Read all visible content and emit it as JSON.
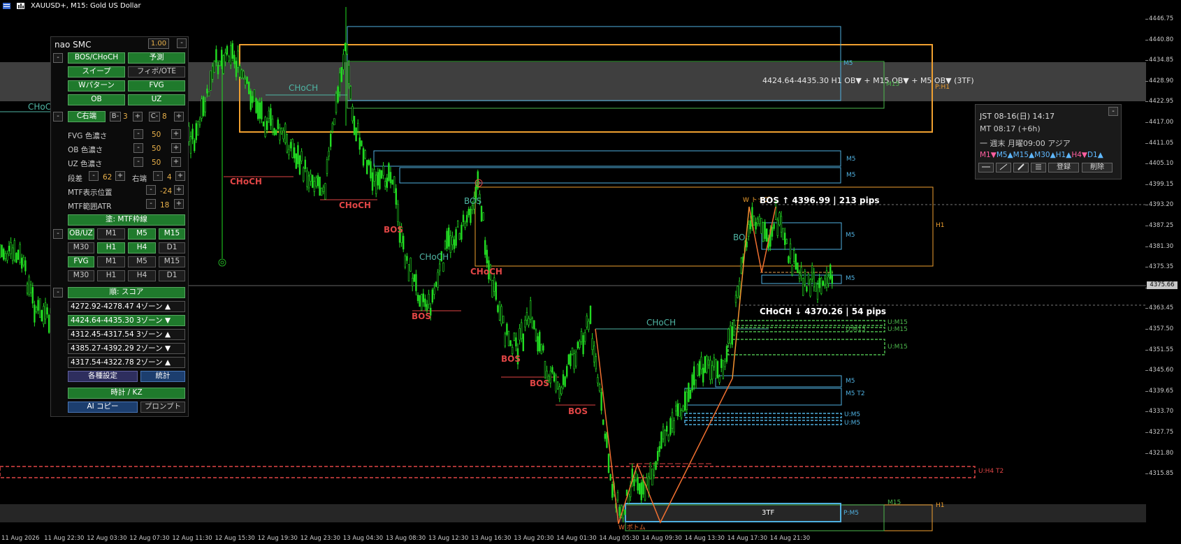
{
  "window": {
    "title": "XAUUSD+, M15:  Gold US Dollar"
  },
  "price_axis": {
    "ticks": [
      "4446.75",
      "4440.80",
      "4434.85",
      "4428.90",
      "4422.95",
      "4417.00",
      "4411.05",
      "4405.10",
      "4399.15",
      "4393.20",
      "4387.25",
      "4381.30",
      "4375.35",
      "4369.40",
      "4363.45",
      "4357.50",
      "4351.55",
      "4345.60",
      "4339.65",
      "4333.70",
      "4327.75",
      "4321.80",
      "4315.85"
    ],
    "current": "4375.66"
  },
  "time_axis": {
    "ticks": [
      "11 Aug 2026",
      "11 Aug 22:30",
      "12 Aug 03:30",
      "12 Aug 07:30",
      "12 Aug 11:30",
      "12 Aug 15:30",
      "12 Aug 19:30",
      "12 Aug 23:30",
      "13 Aug 04:30",
      "13 Aug 08:30",
      "13 Aug 12:30",
      "13 Aug 16:30",
      "13 Aug 20:30",
      "14 Aug 01:30",
      "14 Aug 05:30",
      "14 Aug 09:30",
      "14 Aug 13:30",
      "14 Aug 17:30",
      "14 Aug 21:30"
    ]
  },
  "chart_labels": {
    "choch_left": "CHoCH",
    "choch_teal_1": "CHoCH",
    "choch_red_1": "CHoCH",
    "choch_red_2": "CHoCH",
    "bos_red_1": "BOS",
    "choch_teal_2": "CHoCH",
    "bos_red_2": "BOS",
    "choch_teal_3": "BOS",
    "choch_red_3": "CHoCH",
    "bos_red_3": "BOS",
    "bos_red_4": "BOS",
    "bos_red_5": "BOS",
    "choch_teal_4": "CHoCH",
    "bo_teal": "BO",
    "zone_info": "4424.64-4435.30  H1 OB▼ + M15 OB▼ + M5 OB▼ (3TF)",
    "bos_info": "BOS ↑  4396.99  |  213 pips",
    "choch_info": "CHoCH ↓  4370.26  |  54 pips",
    "w_label": "W トップ",
    "w_bottom": "W ボトム",
    "m5_1": "M5",
    "m15_1": "M15",
    "p_h1": "P:H1",
    "m5_2": "M5",
    "m5_3": "M5",
    "h1_1": "H1",
    "m5_4": "M5",
    "m5_5": "M5",
    "u_m15_1": "U:M15",
    "u_m15_2": "U:M15",
    "u_m15_3": "U:M15",
    "u_m15_4": "U:M15",
    "m5_6": "M5",
    "m5_t2": "M5 T2",
    "u_m5_1": "U:M5",
    "u_m5_2": "U:M5",
    "u_h4_t2": "U:H4 T2",
    "box_3tf": "3TF",
    "p_m5": "P:M5",
    "m15_2": "M15",
    "h1_2": "H1"
  },
  "panel": {
    "title": "nao SMC",
    "scale": "1.00",
    "close": "-",
    "row1": [
      "BOS/CHoCH",
      "予測"
    ],
    "row2": [
      "スイープ",
      "フィボ/OTE"
    ],
    "row3": [
      "Wパターン",
      "FVG"
    ],
    "row4": [
      "OB",
      "UZ"
    ],
    "c_label": "C右端",
    "b_minus": "B-",
    "b_val": "3",
    "c_minus": "C-",
    "c_val": "8",
    "fvg_label": "FVG 色濃さ",
    "fvg_val": "50",
    "ob_label": "OB 色濃さ",
    "ob_val": "50",
    "uz_label": "UZ 色濃さ",
    "uz_val": "50",
    "step_label": "段差",
    "step_val": "62",
    "right_label": "右端",
    "right_val": "4",
    "mtf_pos_label": "MTF表示位置",
    "mtf_pos_val": "-24",
    "mtf_atr_label": "MTF範囲ATR",
    "mtf_atr_val": "18",
    "mtf_frame": "塗: MTF枠線",
    "obuz": "OB/UZ",
    "tf1": [
      "M1",
      "M5",
      "M15"
    ],
    "tf2": [
      "M30",
      "H1",
      "H4",
      "D1"
    ],
    "fvg_tf": "FVG",
    "tf3": [
      "M1",
      "M5",
      "M15"
    ],
    "tf4": [
      "M30",
      "H1",
      "H4",
      "D1"
    ],
    "sort": "順: スコア",
    "zones": [
      {
        "text": "4272.92-4278.47  4ゾーン ▲"
      },
      {
        "text": "4424.64-4435.30  3ゾーン ▼"
      },
      {
        "text": "4312.45-4317.54  3ゾーン ▲"
      },
      {
        "text": "4385.27-4392.29  2ゾーン ▼"
      },
      {
        "text": "4317.54-4322.78  2ゾーン ▲"
      }
    ],
    "settings": "各種設定",
    "stats": "統計",
    "clock_kz": "時計 / KZ",
    "ai_copy": "AI コピー",
    "prompt": "プロンプト",
    "minus": "-",
    "plus": "+"
  },
  "clock": {
    "jst": "JST 08-16(日) 14:17",
    "mt": "MT 08:17 (+6h)",
    "session": "一 週末 月曜09:00 アジア",
    "tf_status": [
      {
        "t": "M1▼",
        "c": "#ff5fa0"
      },
      {
        "t": "M5▲",
        "c": "#5fb8ff"
      },
      {
        "t": "M15▲",
        "c": "#5fb8ff"
      },
      {
        "t": "M30▲",
        "c": "#5fb8ff"
      },
      {
        "t": "H1▲",
        "c": "#5fb8ff"
      },
      {
        "t": "H4▼",
        "c": "#ff5fa0"
      },
      {
        "t": "D1▲",
        "c": "#5fb8ff"
      }
    ],
    "register": "登録",
    "delete": "削除",
    "close": "-"
  },
  "colors": {
    "bull": "#22dd22",
    "bear": "#e04545",
    "teal": "#4fb5a4",
    "orange": "#f0a030",
    "blue": "#4fb0e0",
    "green": "#4cb84c"
  }
}
